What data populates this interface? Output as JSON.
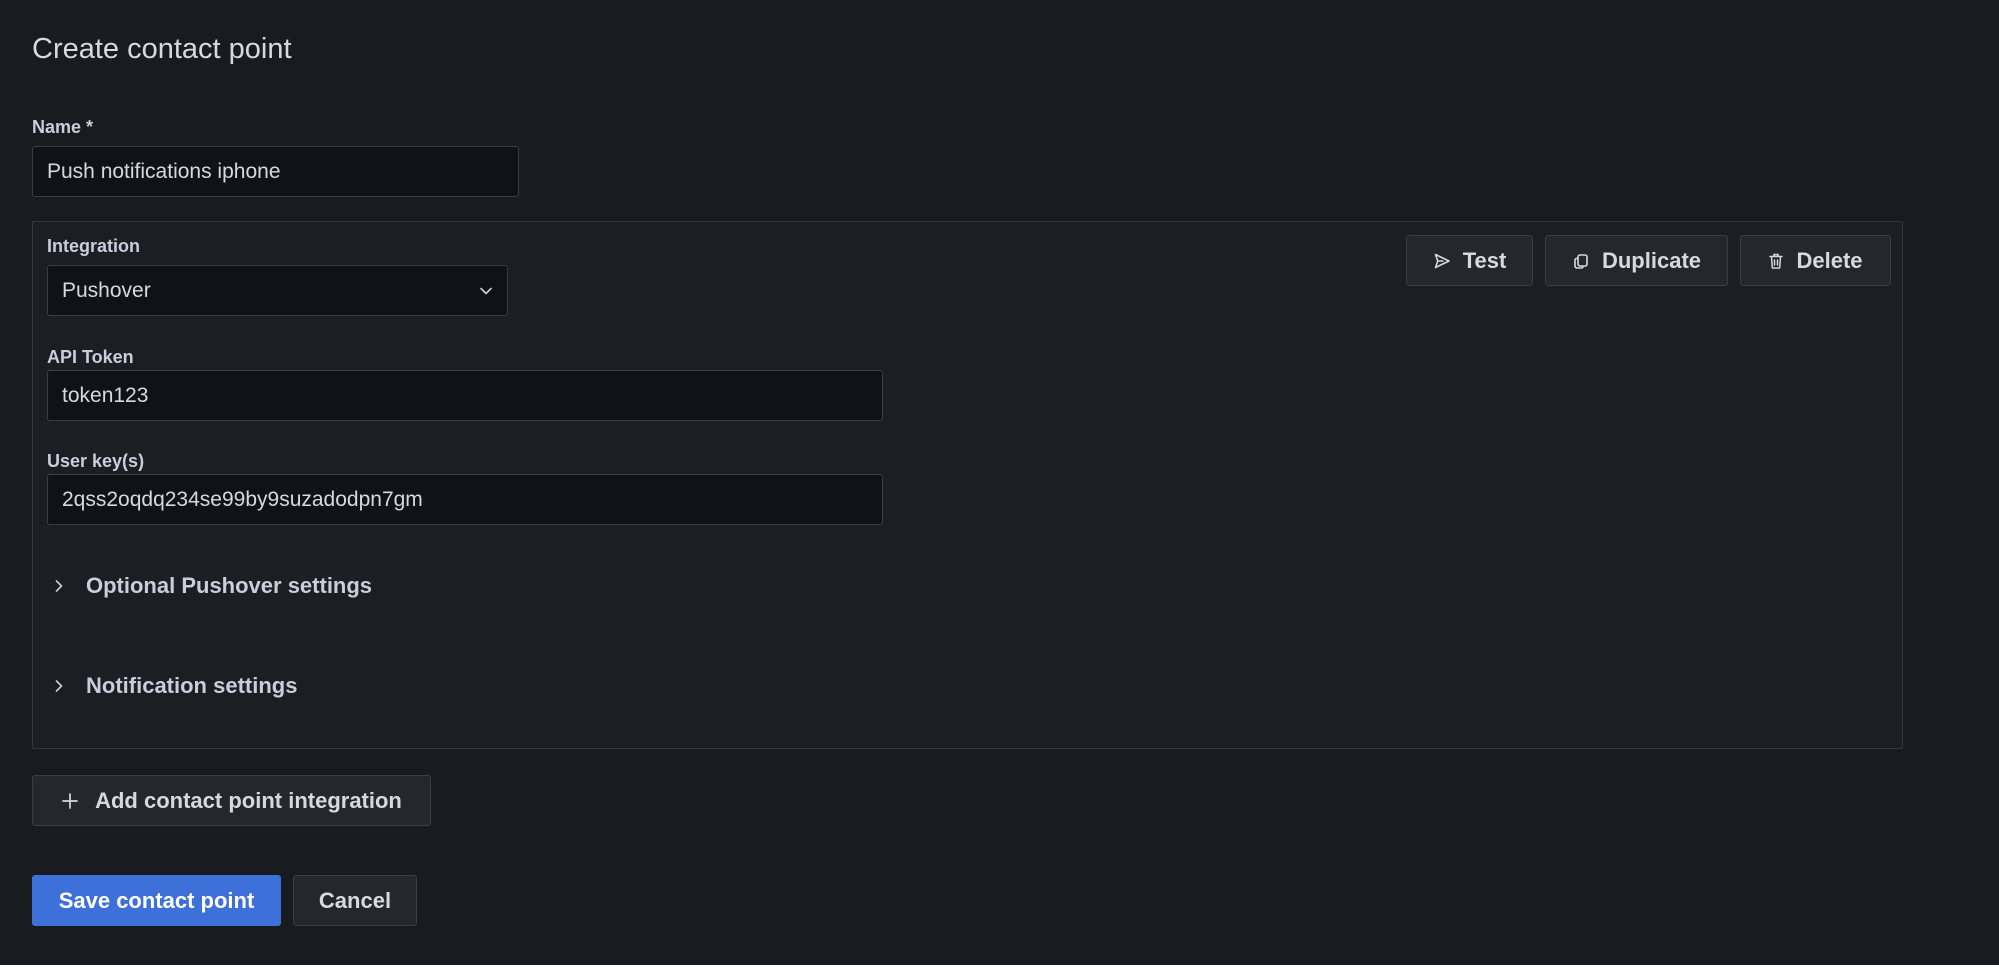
{
  "page": {
    "title": "Create contact point"
  },
  "name_field": {
    "label": "Name *",
    "value": "Push notifications iphone"
  },
  "integration": {
    "label": "Integration",
    "selected": "Pushover",
    "actions": {
      "test": "Test",
      "duplicate": "Duplicate",
      "delete": "Delete"
    },
    "api_token": {
      "label": "API Token",
      "value": "token123"
    },
    "user_keys": {
      "label": "User key(s)",
      "value": "2qss2oqdq234se99by9suzadodpn7gm"
    },
    "sections": {
      "optional": "Optional Pushover settings",
      "notification": "Notification settings"
    }
  },
  "add_integration_label": "Add contact point integration",
  "footer": {
    "save": "Save contact point",
    "cancel": "Cancel"
  },
  "colors": {
    "background": "#181b1f",
    "primary": "#3d71d9",
    "input_bg": "#111217"
  },
  "icons": {
    "test": "send-icon",
    "duplicate": "copy-icon",
    "delete": "trash-icon",
    "add": "plus-icon",
    "select": "chevron-down-icon",
    "section": "chevron-right-icon"
  }
}
